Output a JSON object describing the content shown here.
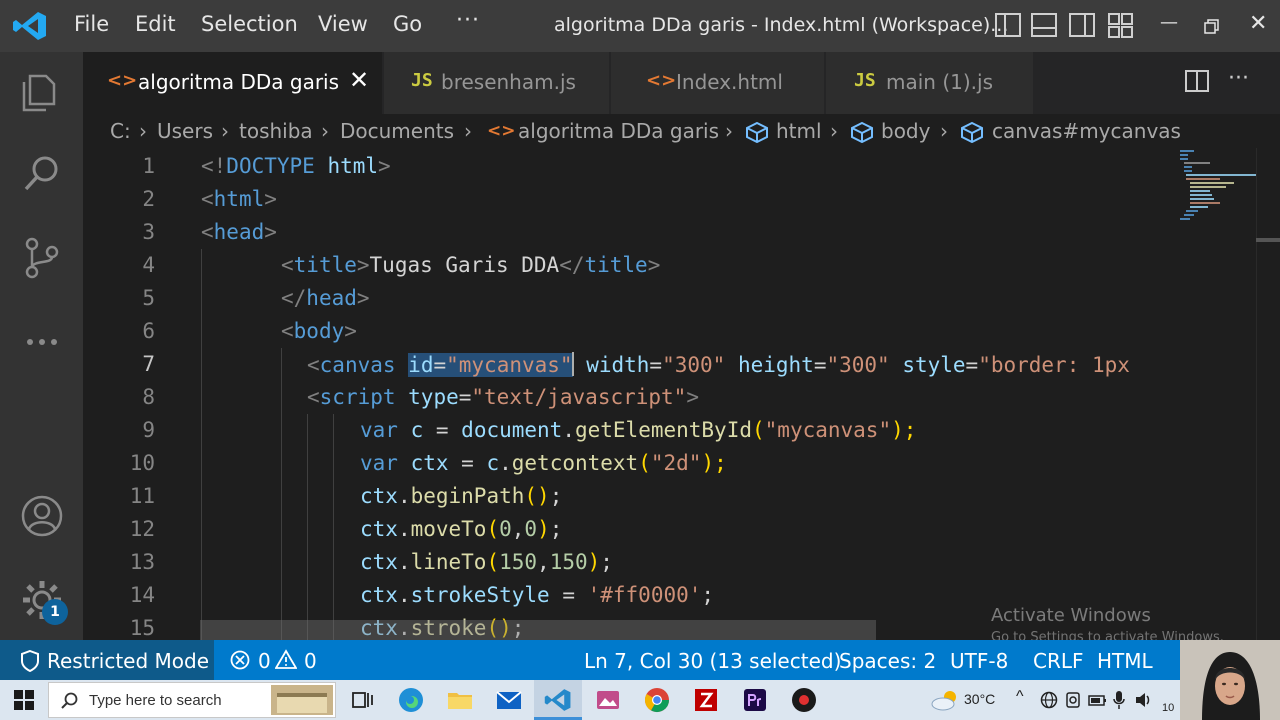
{
  "menu": [
    "File",
    "Edit",
    "Selection",
    "View",
    "Go"
  ],
  "menu_more": "···",
  "window_title": "algoritma DDa garis - Index.html (Workspace)...",
  "tabs": [
    {
      "label": "algoritma DDa garis",
      "icon": "html-icon",
      "active": true
    },
    {
      "label": "bresenham.js",
      "icon": "js-icon",
      "active": false
    },
    {
      "label": "Index.html",
      "icon": "html-icon",
      "active": false
    },
    {
      "label": "main (1).js",
      "icon": "js-icon",
      "active": false
    }
  ],
  "tab_icon_labels": {
    "html": "<>",
    "js": "JS"
  },
  "breadcrumb": [
    "C:",
    "Users",
    "toshiba",
    "Documents",
    "algoritma DDa garis",
    "html",
    "body",
    "canvas#mycanvas"
  ],
  "editor": {
    "lines": [
      "1",
      "2",
      "3",
      "4",
      "5",
      "6",
      "7",
      "8",
      "9",
      "10",
      "11",
      "12",
      "13",
      "14",
      "15"
    ],
    "current_line": "7",
    "code": [
      {
        "t1": "<!",
        "t2": "DOCTYPE",
        "t3": " html",
        "t4": ">"
      },
      {
        "t1": "<",
        "t2": "html",
        "t3": ">"
      },
      {
        "t1": "<",
        "t2": "head",
        "t3": ">"
      },
      {
        "t1": "<",
        "t2": "title",
        "t3": ">",
        "t4": "Tugas Garis DDA",
        "t5": "</",
        "t6": "title",
        "t7": ">"
      },
      {
        "t1": "</",
        "t2": "head",
        "t3": ">"
      },
      {
        "t1": "<",
        "t2": "body",
        "t3": ">"
      },
      {
        "t1": "<",
        "t2": "canvas",
        "t3": " ",
        "t4": "id",
        "t5": "=",
        "t6": "\"mycanvas\"",
        "t7": " width",
        "t8": "=",
        "t9": "\"300\"",
        "t10": " height",
        "t11": "=",
        "t12": "\"300\"",
        "t13": " style",
        "t14": "=",
        "t15": "\"border: 1px"
      },
      {
        "t1": "<",
        "t2": "script",
        "t3": " type",
        "t4": "=",
        "t5": "\"text/javascript\"",
        "t6": ">"
      },
      {
        "t1": "var",
        "t2": " c",
        "t3": " = ",
        "t4": "document",
        "t5": ".",
        "t6": "getElementById",
        "t7": "(",
        "t8": "\"mycanvas\"",
        "t9": ");"
      },
      {
        "t1": "var",
        "t2": " ctx",
        "t3": " = ",
        "t4": "c",
        "t5": ".",
        "t6": "getcontext",
        "t7": "(",
        "t8": "\"2d\"",
        "t9": ");"
      },
      {
        "t1": "ctx",
        "t2": ".",
        "t3": "beginPath",
        "t4": "()",
        "t5": ";"
      },
      {
        "t1": "ctx",
        "t2": ".",
        "t3": "moveTo",
        "t4": "(",
        "t5": "0",
        "t6": ",",
        "t7": "0",
        "t8": ")",
        "t9": ";"
      },
      {
        "t1": "ctx",
        "t2": ".",
        "t3": "lineTo",
        "t4": "(",
        "t5": "150",
        "t6": ",",
        "t7": "150",
        "t8": ")",
        "t9": ";"
      },
      {
        "t1": "ctx",
        "t2": ".",
        "t3": "strokeStyle",
        "t4": " = ",
        "t5": "'#ff0000'",
        "t6": ";"
      },
      {
        "t1": "ctx",
        "t2": ".",
        "t3": "stroke",
        "t4": "()",
        "t5": ";"
      }
    ]
  },
  "watermark": {
    "line1": "Activate Windows",
    "line2": "Go to Settings to activate Windows."
  },
  "status": {
    "restricted": "Restricted Mode",
    "errors": "0",
    "warnings": "0",
    "position": "Ln 7, Col 30 (13 selected)",
    "spaces": "Spaces: 2",
    "encoding": "UTF-8",
    "eol": "CRLF",
    "language": "HTML"
  },
  "badge": "1",
  "taskbar": {
    "search_placeholder": "Type here to search",
    "temperature": "30°C",
    "clock": "10"
  },
  "colors": {
    "accent": "#007acc",
    "title_bar": "#3c3c3c",
    "editor_bg": "#1e1e1e",
    "selection": "#264f78"
  }
}
